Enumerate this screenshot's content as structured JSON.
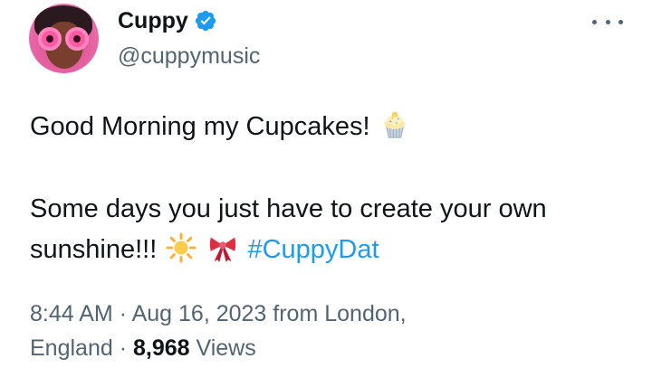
{
  "author": {
    "display_name": "Cuppy",
    "handle": "@cuppymusic",
    "verified": true,
    "accent_color": "#1d9bf0"
  },
  "icons": {
    "more": "more-horizontal-icon",
    "verified": "verified-badge-icon",
    "cupcake": "cupcake-emoji",
    "sun": "sun-emoji",
    "ribbon": "ribbon-emoji"
  },
  "tweet": {
    "line1": "Good Morning my Cupcakes!",
    "line2": "Some days you just have to create your own",
    "line3": "sunshine!!!",
    "hashtag": "#CuppyDat"
  },
  "meta": {
    "time": "8:44 AM",
    "sep1": "·",
    "date": "Aug 16, 2023 from London,",
    "location_end": "England",
    "sep2": "·",
    "views_count": "8,968",
    "views_label": "Views"
  }
}
